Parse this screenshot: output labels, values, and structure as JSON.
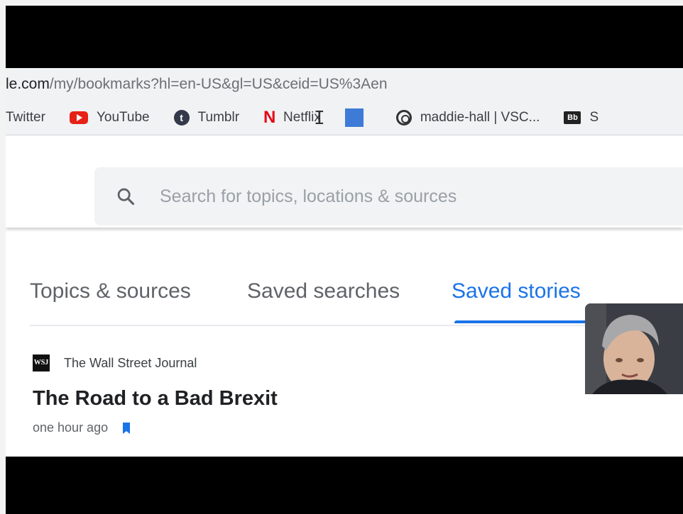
{
  "browser": {
    "url_host": "le.com",
    "url_path": "/my/bookmarks?hl=en-US&gl=US&ceid=US%3Aen"
  },
  "bookmarks": [
    {
      "label": "Twitter",
      "icon": "twitter-icon"
    },
    {
      "label": "YouTube",
      "icon": "youtube-icon"
    },
    {
      "label": "Tumblr",
      "icon": "tumblr-icon"
    },
    {
      "label": "Netflix",
      "icon": "netflix-icon"
    },
    {
      "label": "",
      "icon": "blue-bookmark-icon"
    },
    {
      "label": "maddie-hall | VSC...",
      "icon": "vsco-icon"
    },
    {
      "label": "S",
      "icon": "blackboard-icon"
    }
  ],
  "search": {
    "placeholder": "Search for topics, locations & sources"
  },
  "tabs": [
    {
      "label": "Topics & sources",
      "active": false
    },
    {
      "label": "Saved searches",
      "active": false
    },
    {
      "label": "Saved stories",
      "active": true
    }
  ],
  "story": {
    "source_logo": "WSJ",
    "source": "The Wall Street Journal",
    "headline": "The Road to a Bad Brexit",
    "time": "one hour ago"
  },
  "colors": {
    "accent": "#1a73e8",
    "frame": "#000000"
  }
}
